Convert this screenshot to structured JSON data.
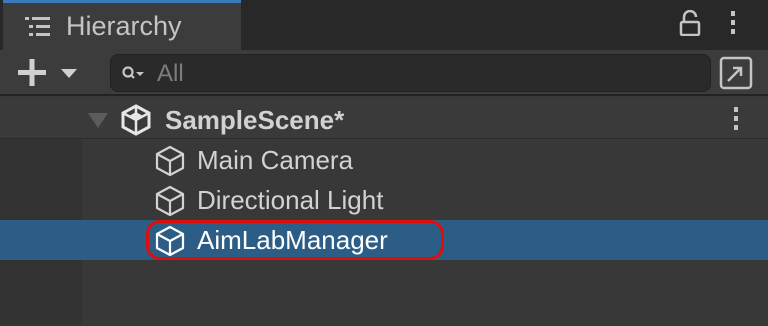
{
  "panel": {
    "tab_title": "Hierarchy",
    "tab_icon": "hierarchy-list-icon",
    "actions": [
      "lock-icon",
      "more-options-icon"
    ]
  },
  "toolbar": {
    "add_icon": "plus-dropdown-icon",
    "search": {
      "icon": "search-icon",
      "placeholder": "All",
      "value": ""
    },
    "scene_view_icon": "scene-visibility-icon"
  },
  "scene": {
    "name": "SampleScene*",
    "icon": "unity-scene-icon",
    "expanded": true
  },
  "objects": [
    {
      "name": "Main Camera",
      "icon": "gameobject-cube-icon",
      "selected": false
    },
    {
      "name": "Directional Light",
      "icon": "gameobject-cube-icon",
      "selected": false
    },
    {
      "name": "AimLabManager",
      "icon": "gameobject-cube-icon",
      "selected": true,
      "annotated": true
    }
  ],
  "colors": {
    "selection": "#2c5d87",
    "annotation_outline": "#e00d0d",
    "tab_accent": "#3a79bb"
  }
}
